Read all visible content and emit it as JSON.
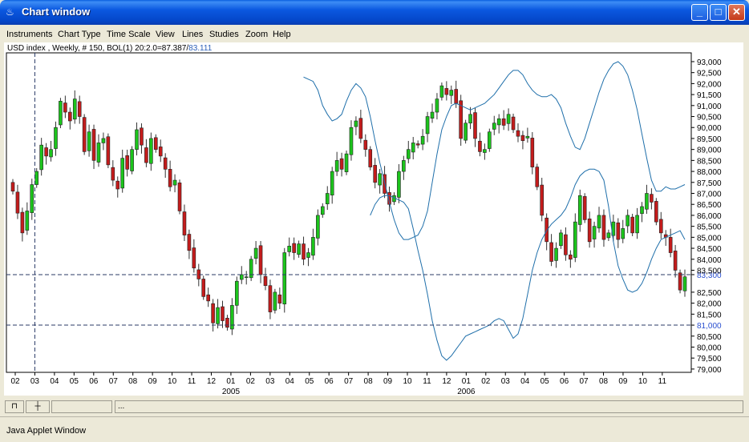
{
  "window": {
    "title": "Chart window",
    "icon": "java-cup-icon",
    "buttons": [
      "minimize-icon",
      "maximize-icon",
      "close-icon"
    ]
  },
  "menu": [
    "Instruments",
    "Chart Type",
    "Time Scale",
    "View",
    "Lines",
    "Studies",
    "Zoom",
    "Help"
  ],
  "info": {
    "prefix": "USD index , Weekly, # 150, BOL(1) 20:2.0=87.387/",
    "lower_value": "83.111"
  },
  "price_labels": [
    "93,000",
    "92,500",
    "92,000",
    "91,500",
    "91,000",
    "90,500",
    "90,000",
    "89,500",
    "89,000",
    "88,500",
    "88,000",
    "87,500",
    "87,000",
    "86,500",
    "86,000",
    "85,500",
    "85,000",
    "84,500",
    "84,000",
    "83,500",
    "83,300",
    "82,500",
    "82,000",
    "81,500",
    "81,000",
    "80,500",
    "80,000",
    "79,500",
    "79,000"
  ],
  "month_labels": [
    "02",
    "03",
    "04",
    "05",
    "06",
    "07",
    "08",
    "09",
    "10",
    "11",
    "12",
    "01",
    "02",
    "03",
    "04",
    "05",
    "06",
    "07",
    "08",
    "09",
    "10",
    "11",
    "12",
    "01",
    "02",
    "03",
    "04",
    "05",
    "06",
    "07",
    "08",
    "09",
    "10",
    "11"
  ],
  "year_labels": [
    "2005",
    "2006"
  ],
  "statusbar": {
    "flag_icon": "pin-icon",
    "line_icon": "crosshair-icon",
    "text": "..."
  },
  "applet_label": "Java Applet Window",
  "colors": {
    "up_candle": "#1cc41c",
    "down_candle": "#c41c1c",
    "band_line": "#1f6faa",
    "hline": "#2a3a66",
    "price_label_highlight": "#2a4fd0"
  },
  "chart_data": {
    "type": "candlestick",
    "instrument": "USD index",
    "period": "Weekly",
    "indicator": "BOL(1) 20:2.0",
    "upper_band_value": 87.387,
    "lower_band_value": 83.111,
    "ylim": [
      79.0,
      93.3
    ],
    "highlighted_levels": [
      83.3,
      81.0
    ],
    "ticks_y": [
      79.0,
      79.5,
      80.0,
      80.5,
      81.0,
      81.5,
      82.0,
      82.5,
      83.3,
      83.5,
      84.0,
      84.5,
      85.0,
      85.5,
      86.0,
      86.5,
      87.0,
      87.5,
      88.0,
      88.5,
      89.0,
      89.5,
      90.0,
      90.5,
      91.0,
      91.5,
      92.0,
      92.5,
      93.0
    ],
    "x_axis": {
      "months": [
        "02",
        "03",
        "04",
        "05",
        "06",
        "07",
        "08",
        "09",
        "10",
        "11",
        "12",
        "01",
        "02",
        "03",
        "04",
        "05",
        "06",
        "07",
        "08",
        "09",
        "10",
        "11",
        "12",
        "01",
        "02",
        "03",
        "04",
        "05",
        "06",
        "07",
        "08",
        "09",
        "10",
        "11"
      ],
      "years": [
        "2005",
        "2006"
      ]
    },
    "closes": [
      87.1,
      86.1,
      85.2,
      86.2,
      87.4,
      88.0,
      89.2,
      88.7,
      89.0,
      90.0,
      91.2,
      90.7,
      90.3,
      91.3,
      90.5,
      88.9,
      89.8,
      88.5,
      89.3,
      89.5,
      88.3,
      87.6,
      87.2,
      88.6,
      88.1,
      89.0,
      89.9,
      89.2,
      88.4,
      89.5,
      89.0,
      88.7,
      88.1,
      87.3,
      87.6,
      86.2,
      85.1,
      84.4,
      83.6,
      83.1,
      82.3,
      82.1,
      81.1,
      81.8,
      81.2,
      80.9,
      81.9,
      83.0,
      83.3,
      83.2,
      84.0,
      84.5,
      83.3,
      82.8,
      81.6,
      82.5,
      82.0,
      84.3,
      84.6,
      84.3,
      84.7,
      84.0,
      84.3,
      85.0,
      86.0,
      86.4,
      87.0,
      88.0,
      88.5,
      88.1,
      88.8,
      90.0,
      90.3,
      89.5,
      89.0,
      88.2,
      87.5,
      87.9,
      87.0,
      86.5,
      86.9,
      88.0,
      88.5,
      89.0,
      89.3,
      89.2,
      89.6,
      90.5,
      90.7,
      91.3,
      91.9,
      91.5,
      91.7,
      91.1,
      89.5,
      90.2,
      90.6,
      89.5,
      88.9,
      89.0,
      89.8,
      90.2,
      90.4,
      90.1,
      90.6,
      89.9,
      89.6,
      89.4,
      89.6,
      88.2,
      87.3,
      86.0,
      84.8,
      83.9,
      84.5,
      85.2,
      84.2,
      84.0,
      85.7,
      86.9,
      85.8,
      84.8,
      85.5,
      86.0,
      84.9,
      85.2,
      85.7,
      84.9,
      85.4,
      86.0,
      85.2,
      86.0,
      86.4,
      87.0,
      86.6,
      85.7,
      85.2,
      85.0,
      84.3,
      83.5,
      82.6,
      83.2
    ],
    "upper_band": [
      null,
      null,
      null,
      null,
      null,
      null,
      null,
      null,
      null,
      null,
      null,
      null,
      null,
      null,
      null,
      null,
      null,
      null,
      null,
      null,
      null,
      null,
      92.3,
      92.2,
      92.1,
      91.7,
      91.0,
      90.6,
      90.3,
      90.4,
      90.6,
      91.2,
      91.7,
      92.0,
      91.8,
      91.4,
      90.5,
      89.4,
      88.4,
      87.5,
      86.6,
      85.8,
      85.2,
      84.9,
      84.9,
      85.0,
      85.1,
      85.5,
      86.2,
      87.5,
      88.8,
      89.9,
      90.5,
      91.0,
      91.1,
      91.0,
      90.9,
      90.8,
      90.9,
      91.0,
      91.1,
      91.3,
      91.5,
      91.8,
      92.1,
      92.4,
      92.6,
      92.6,
      92.4,
      92.0,
      91.7,
      91.5,
      91.4,
      91.4,
      91.5,
      91.3,
      90.9,
      90.2,
      89.6,
      89.1,
      89.0,
      89.5,
      90.2,
      90.9,
      91.6,
      92.2,
      92.6,
      92.9,
      93.0,
      92.8,
      92.4,
      91.7,
      90.8,
      89.7,
      88.6,
      87.6,
      87.1,
      87.1,
      87.3,
      87.2,
      87.2,
      87.3,
      87.4
    ],
    "lower_band": [
      null,
      null,
      null,
      null,
      null,
      null,
      null,
      null,
      null,
      null,
      null,
      null,
      null,
      null,
      null,
      null,
      null,
      null,
      null,
      null,
      null,
      null,
      86.0,
      86.5,
      86.8,
      86.9,
      86.9,
      86.8,
      86.7,
      86.6,
      86.3,
      85.4,
      84.4,
      83.5,
      82.4,
      81.2,
      80.3,
      79.6,
      79.4,
      79.6,
      79.9,
      80.2,
      80.5,
      80.6,
      80.7,
      80.8,
      80.9,
      81.0,
      81.2,
      81.3,
      81.2,
      80.8,
      80.4,
      80.6,
      81.3,
      82.4,
      83.5,
      84.3,
      84.9,
      85.3,
      85.6,
      85.8,
      86.0,
      86.3,
      86.8,
      87.4,
      87.8,
      88.0,
      88.1,
      88.1,
      88.0,
      87.6,
      86.4,
      84.8,
      83.7,
      83.1,
      82.6,
      82.5,
      82.6,
      82.9,
      83.4,
      84.0,
      84.5,
      84.9,
      85.0,
      85.1,
      85.2,
      85.3,
      84.9
    ]
  }
}
